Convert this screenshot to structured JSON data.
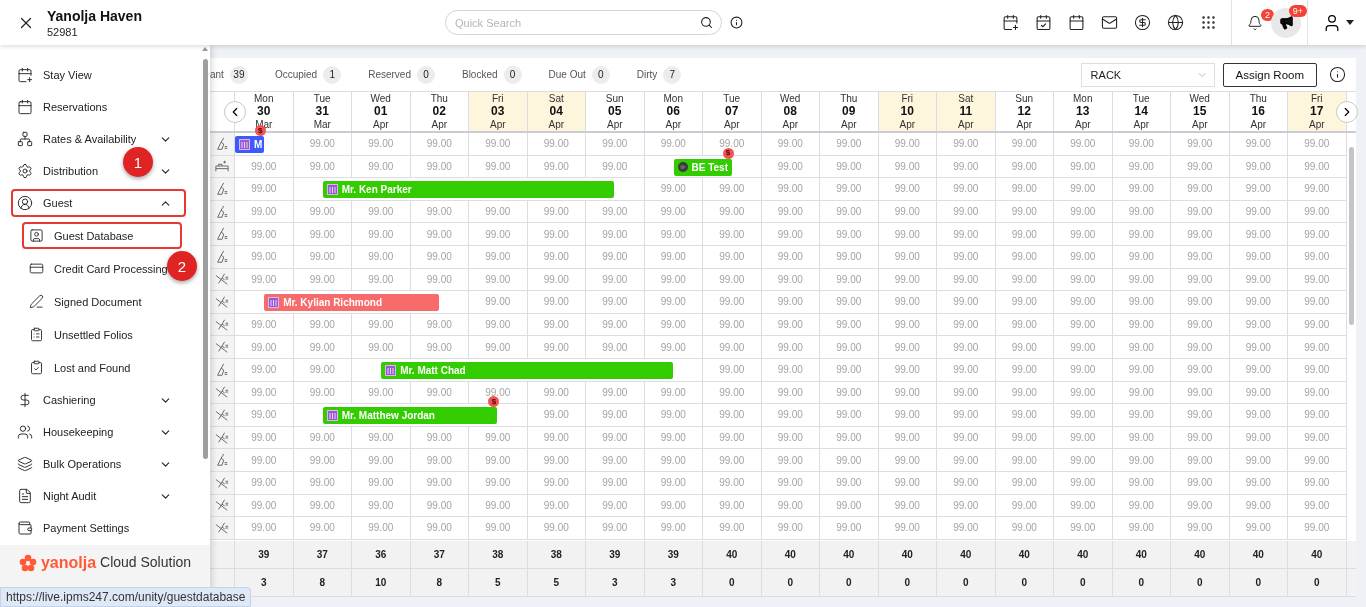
{
  "header": {
    "property_name": "Yanolja Haven",
    "property_code": "52981",
    "search": {
      "placeholder": "Quick Search"
    },
    "notifications": "2",
    "announcements": "9+"
  },
  "sidebar": {
    "items": [
      {
        "label": "Stay View",
        "kind": "link",
        "highlighted": false
      },
      {
        "label": "Reservations",
        "kind": "link",
        "highlighted": false
      },
      {
        "label": "Rates & Availability",
        "kind": "group",
        "expanded": false,
        "highlighted": false
      },
      {
        "label": "Distribution",
        "kind": "group",
        "expanded": false,
        "highlighted": false
      },
      {
        "label": "Guest",
        "kind": "group",
        "expanded": true,
        "highlighted": true,
        "callout": "1",
        "children": [
          {
            "label": "Guest Database",
            "highlighted": true,
            "callout": "2"
          },
          {
            "label": "Credit Card Processing",
            "highlighted": false
          },
          {
            "label": "Signed Document",
            "highlighted": false
          },
          {
            "label": "Unsettled Folios",
            "highlighted": false
          },
          {
            "label": "Lost and Found",
            "highlighted": false
          }
        ]
      },
      {
        "label": "Cashiering",
        "kind": "group",
        "expanded": false,
        "highlighted": false
      },
      {
        "label": "Housekeeping",
        "kind": "group",
        "expanded": false,
        "highlighted": false
      },
      {
        "label": "Bulk Operations",
        "kind": "group",
        "expanded": false,
        "highlighted": false
      },
      {
        "label": "Night Audit",
        "kind": "group",
        "expanded": false,
        "highlighted": false
      },
      {
        "label": "Payment Settings",
        "kind": "link",
        "highlighted": false
      }
    ],
    "brand": {
      "name": "yanolja",
      "tagline": "Cloud Solution"
    }
  },
  "status_url": "https://live.ipms247.com/unity/guestdatabase",
  "stats": [
    {
      "label": "ant",
      "count": "39"
    },
    {
      "label": "Occupied",
      "count": "1"
    },
    {
      "label": "Reserved",
      "count": "0"
    },
    {
      "label": "Blocked",
      "count": "0"
    },
    {
      "label": "Due Out",
      "count": "0"
    },
    {
      "label": "Dirty",
      "count": "7"
    }
  ],
  "rate_plan": "RACK",
  "assign_button": "Assign Room",
  "dates": [
    {
      "weekday": "Mon",
      "day": "30",
      "month": "Mar",
      "weekend": false
    },
    {
      "weekday": "Tue",
      "day": "31",
      "month": "Mar",
      "weekend": false
    },
    {
      "weekday": "Wed",
      "day": "01",
      "month": "Apr",
      "weekend": false
    },
    {
      "weekday": "Thu",
      "day": "02",
      "month": "Apr",
      "weekend": false
    },
    {
      "weekday": "Fri",
      "day": "03",
      "month": "Apr",
      "weekend": true
    },
    {
      "weekday": "Sat",
      "day": "04",
      "month": "Apr",
      "weekend": true
    },
    {
      "weekday": "Sun",
      "day": "05",
      "month": "Apr",
      "weekend": false
    },
    {
      "weekday": "Mon",
      "day": "06",
      "month": "Apr",
      "weekend": false
    },
    {
      "weekday": "Tue",
      "day": "07",
      "month": "Apr",
      "weekend": false
    },
    {
      "weekday": "Wed",
      "day": "08",
      "month": "Apr",
      "weekend": false
    },
    {
      "weekday": "Thu",
      "day": "09",
      "month": "Apr",
      "weekend": false
    },
    {
      "weekday": "Fri",
      "day": "10",
      "month": "Apr",
      "weekend": true
    },
    {
      "weekday": "Sat",
      "day": "11",
      "month": "Apr",
      "weekend": true
    },
    {
      "weekday": "Sun",
      "day": "12",
      "month": "Apr",
      "weekend": false
    },
    {
      "weekday": "Mon",
      "day": "13",
      "month": "Apr",
      "weekend": false
    },
    {
      "weekday": "Tue",
      "day": "14",
      "month": "Apr",
      "weekend": false
    },
    {
      "weekday": "Wed",
      "day": "15",
      "month": "Apr",
      "weekend": false
    },
    {
      "weekday": "Thu",
      "day": "16",
      "month": "Apr",
      "weekend": false
    },
    {
      "weekday": "Fri",
      "day": "17",
      "month": "Apr",
      "weekend": true
    }
  ],
  "rows": [
    {
      "kind": "clean",
      "cells": [
        {
          "kind": "booking-continued",
          "guest": "M",
          "color": "#3d5afe",
          "online": false,
          "badge": "$"
        },
        "99.00",
        "99.00",
        "99.00",
        "99.00",
        "99.00",
        "99.00",
        "99.00",
        "99.00",
        "99.00",
        "99.00",
        "99.00",
        "99.00",
        "99.00",
        "99.00",
        "99.00",
        "99.00",
        "99.00",
        "99.00"
      ]
    },
    {
      "kind": "inspected",
      "cells": [
        "99.00",
        "99.00",
        "99.00",
        "99.00",
        "99.00",
        "99.00",
        "99.00",
        {
          "kind": "booking",
          "guest": "BE Test",
          "color": "#33cc00",
          "online": true,
          "badge": "$"
        },
        {
          "kind": "covered"
        },
        "99.00",
        "99.00",
        "99.00",
        "99.00",
        "99.00",
        "99.00",
        "99.00",
        "99.00",
        "99.00",
        "99.00"
      ]
    },
    {
      "kind": "clean",
      "cells": [
        "99.00",
        {
          "kind": "booking",
          "guest": "Mr. Ken Parker",
          "color": "#33cc00",
          "online": false
        },
        {
          "kind": "covered"
        },
        {
          "kind": "covered"
        },
        {
          "kind": "covered"
        },
        {
          "kind": "covered"
        },
        {
          "kind": "covered"
        },
        "99.00",
        "99.00",
        "99.00",
        "99.00",
        "99.00",
        "99.00",
        "99.00",
        "99.00",
        "99.00",
        "99.00",
        "99.00",
        "99.00"
      ]
    },
    {
      "kind": "clean",
      "cells": [
        "99.00",
        "99.00",
        "99.00",
        "99.00",
        "99.00",
        "99.00",
        "99.00",
        "99.00",
        "99.00",
        "99.00",
        "99.00",
        "99.00",
        "99.00",
        "99.00",
        "99.00",
        "99.00",
        "99.00",
        "99.00",
        "99.00"
      ]
    },
    {
      "kind": "clean",
      "cells": [
        "99.00",
        "99.00",
        "99.00",
        "99.00",
        "99.00",
        "99.00",
        "99.00",
        "99.00",
        "99.00",
        "99.00",
        "99.00",
        "99.00",
        "99.00",
        "99.00",
        "99.00",
        "99.00",
        "99.00",
        "99.00",
        "99.00"
      ]
    },
    {
      "kind": "clean",
      "cells": [
        "99.00",
        "99.00",
        "99.00",
        "99.00",
        "99.00",
        "99.00",
        "99.00",
        "99.00",
        "99.00",
        "99.00",
        "99.00",
        "99.00",
        "99.00",
        "99.00",
        "99.00",
        "99.00",
        "99.00",
        "99.00",
        "99.00"
      ]
    },
    {
      "kind": "dirty",
      "cells": [
        "99.00",
        "99.00",
        "99.00",
        "99.00",
        "99.00",
        "99.00",
        "99.00",
        "99.00",
        "99.00",
        "99.00",
        "99.00",
        "99.00",
        "99.00",
        "99.00",
        "99.00",
        "99.00",
        "99.00",
        "99.00",
        "99.00"
      ]
    },
    {
      "kind": "dirty",
      "cells": [
        {
          "kind": "booking",
          "guest": "Mr. Kylian Richmond",
          "color": "#f76b6b",
          "online": false
        },
        {
          "kind": "covered"
        },
        {
          "kind": "covered"
        },
        {
          "kind": "covered"
        },
        "99.00",
        "99.00",
        "99.00",
        "99.00",
        "99.00",
        "99.00",
        "99.00",
        "99.00",
        "99.00",
        "99.00",
        "99.00",
        "99.00",
        "99.00",
        "99.00",
        "99.00"
      ]
    },
    {
      "kind": "dirty",
      "cells": [
        "99.00",
        "99.00",
        "99.00",
        "99.00",
        "99.00",
        "99.00",
        "99.00",
        "99.00",
        "99.00",
        "99.00",
        "99.00",
        "99.00",
        "99.00",
        "99.00",
        "99.00",
        "99.00",
        "99.00",
        "99.00",
        "99.00"
      ]
    },
    {
      "kind": "dirty",
      "cells": [
        "99.00",
        "99.00",
        "99.00",
        "99.00",
        "99.00",
        "99.00",
        "99.00",
        "99.00",
        "99.00",
        "99.00",
        "99.00",
        "99.00",
        "99.00",
        "99.00",
        "99.00",
        "99.00",
        "99.00",
        "99.00",
        "99.00"
      ]
    },
    {
      "kind": "clean",
      "cells": [
        "99.00",
        "99.00",
        {
          "kind": "booking",
          "guest": "Mr. Matt Chad",
          "color": "#33cc00",
          "online": false
        },
        {
          "kind": "covered"
        },
        {
          "kind": "covered"
        },
        {
          "kind": "covered"
        },
        {
          "kind": "covered"
        },
        {
          "kind": "covered"
        },
        "99.00",
        "99.00",
        "99.00",
        "99.00",
        "99.00",
        "99.00",
        "99.00",
        "99.00",
        "99.00",
        "99.00",
        "99.00"
      ]
    },
    {
      "kind": "dirty",
      "cells": [
        "99.00",
        "99.00",
        "99.00",
        "99.00",
        "99.00",
        "99.00",
        "99.00",
        "99.00",
        "99.00",
        "99.00",
        "99.00",
        "99.00",
        "99.00",
        "99.00",
        "99.00",
        "99.00",
        "99.00",
        "99.00",
        "99.00"
      ]
    },
    {
      "kind": "dirty",
      "cells": [
        "99.00",
        {
          "kind": "booking",
          "guest": "Mr. Matthew Jordan",
          "color": "#33cc00",
          "online": false,
          "badge": "$"
        },
        {
          "kind": "covered"
        },
        {
          "kind": "covered"
        },
        {
          "kind": "covered"
        },
        "99.00",
        "99.00",
        "99.00",
        "99.00",
        "99.00",
        "99.00",
        "99.00",
        "99.00",
        "99.00",
        "99.00",
        "99.00",
        "99.00",
        "99.00",
        "99.00"
      ]
    },
    {
      "kind": "dirty",
      "cells": [
        "99.00",
        "99.00",
        "99.00",
        "99.00",
        "99.00",
        "99.00",
        "99.00",
        "99.00",
        "99.00",
        "99.00",
        "99.00",
        "99.00",
        "99.00",
        "99.00",
        "99.00",
        "99.00",
        "99.00",
        "99.00",
        "99.00"
      ]
    },
    {
      "kind": "clean",
      "cells": [
        "99.00",
        "99.00",
        "99.00",
        "99.00",
        "99.00",
        "99.00",
        "99.00",
        "99.00",
        "99.00",
        "99.00",
        "99.00",
        "99.00",
        "99.00",
        "99.00",
        "99.00",
        "99.00",
        "99.00",
        "99.00",
        "99.00"
      ]
    },
    {
      "kind": "dirty",
      "cells": [
        "99.00",
        "99.00",
        "99.00",
        "99.00",
        "99.00",
        "99.00",
        "99.00",
        "99.00",
        "99.00",
        "99.00",
        "99.00",
        "99.00",
        "99.00",
        "99.00",
        "99.00",
        "99.00",
        "99.00",
        "99.00",
        "99.00"
      ]
    },
    {
      "kind": "dirty",
      "cells": [
        "99.00",
        "99.00",
        "99.00",
        "99.00",
        "99.00",
        "99.00",
        "99.00",
        "99.00",
        "99.00",
        "99.00",
        "99.00",
        "99.00",
        "99.00",
        "99.00",
        "99.00",
        "99.00",
        "99.00",
        "99.00",
        "99.00"
      ]
    },
    {
      "kind": "dirty",
      "cells": [
        "99.00",
        "99.00",
        "99.00",
        "99.00",
        "99.00",
        "99.00",
        "99.00",
        "99.00",
        "99.00",
        "99.00",
        "99.00",
        "99.00",
        "99.00",
        "99.00",
        "99.00",
        "99.00",
        "99.00",
        "99.00",
        "99.00"
      ]
    }
  ],
  "totals": [
    [
      "39",
      "37",
      "36",
      "37",
      "38",
      "38",
      "39",
      "39",
      "40",
      "40",
      "40",
      "40",
      "40",
      "40",
      "40",
      "40",
      "40",
      "40",
      "40"
    ],
    [
      "3",
      "8",
      "10",
      "8",
      "5",
      "5",
      "3",
      "3",
      "0",
      "0",
      "0",
      "0",
      "0",
      "0",
      "0",
      "0",
      "0",
      "0",
      "0"
    ]
  ]
}
